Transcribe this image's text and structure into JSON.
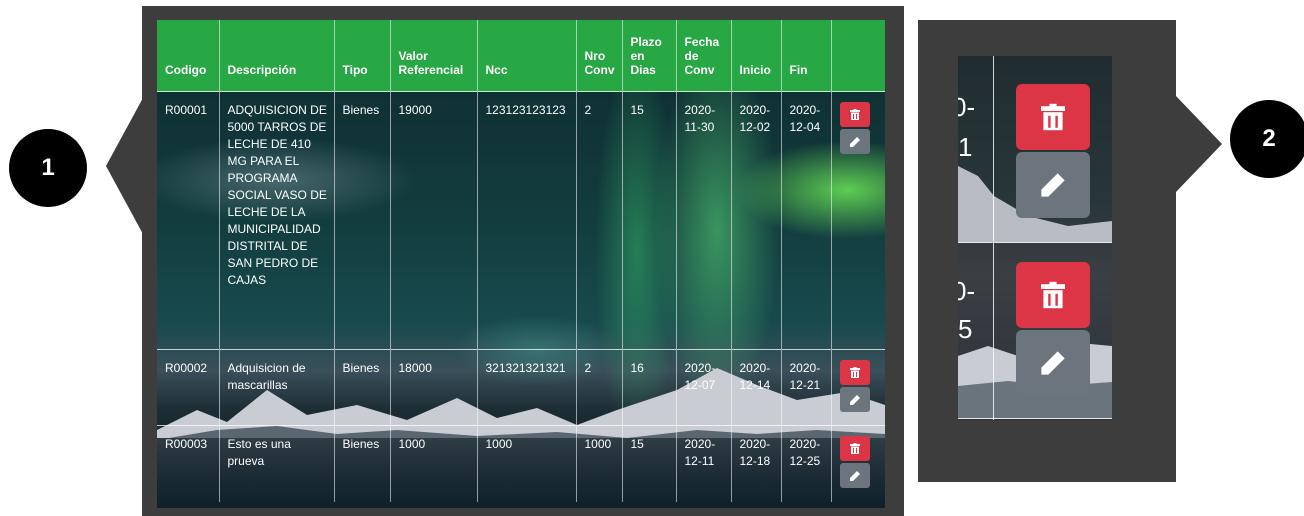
{
  "callouts": [
    "1",
    "2"
  ],
  "colors": {
    "header_bg": "#28a745",
    "delete_btn": "#dc3545",
    "edit_btn": "#6c757d",
    "frame": "#3d3d3d"
  },
  "table": {
    "headers": {
      "codigo": "Codigo",
      "descripcion": "Descripción",
      "tipo": "Tipo",
      "valor": "Valor Referencial",
      "ncc": "Ncc",
      "nro": "Nro Conv",
      "plazo": "Plazo en Dias",
      "fecha": "Fecha de Conv",
      "inicio": "Inicio",
      "fin": "Fin"
    },
    "rows": [
      {
        "codigo": "R00001",
        "descripcion": "ADQUISICION DE 5000 TARROS DE LECHE DE 410 MG PARA EL PROGRAMA SOCIAL VASO DE LECHE DE LA MUNICIPALIDAD DISTRITAL DE SAN PEDRO DE CAJAS",
        "tipo": "Bienes",
        "valor": "19000",
        "ncc": "123123123123",
        "nro": "2",
        "plazo": "15",
        "fecha": "2020-11-30",
        "inicio": "2020-12-02",
        "fin": "2020-12-04"
      },
      {
        "codigo": "R00002",
        "descripcion": "Adquisicion de mascarillas",
        "tipo": "Bienes",
        "valor": "18000",
        "ncc": "321321321321",
        "nro": "2",
        "plazo": "16",
        "fecha": "2020-12-07",
        "inicio": "2020-12-14",
        "fin": "2020-12-21"
      },
      {
        "codigo": "R00003",
        "descripcion": "Esto es una prueva",
        "tipo": "Bienes",
        "valor": "1000",
        "ncc": "1000",
        "nro": "1000",
        "plazo": "15",
        "fecha": "2020-12-11",
        "inicio": "2020-12-18",
        "fin": "2020-12-25"
      }
    ],
    "actions": {
      "delete_icon": "trash-icon",
      "edit_icon": "pen-icon"
    }
  },
  "zoom": {
    "fragments": [
      "0-",
      "1",
      "0-",
      "5"
    ]
  }
}
